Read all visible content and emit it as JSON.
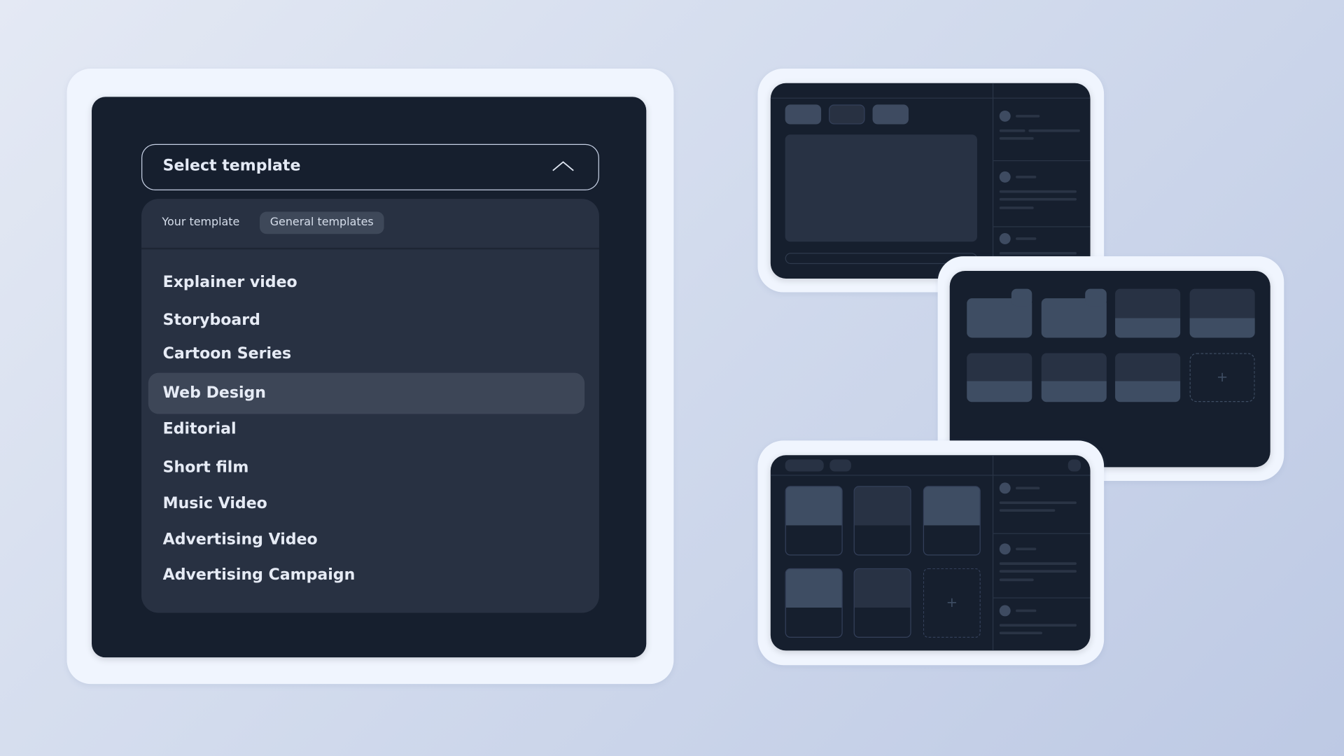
{
  "select": {
    "label": "Select template",
    "icon": "chevron-up-icon",
    "expanded": true
  },
  "tabs": [
    {
      "label": "Your template",
      "active": false
    },
    {
      "label": "General templates",
      "active": true
    }
  ],
  "items": [
    {
      "label": "Explainer video"
    },
    {
      "label": "Storyboard"
    },
    {
      "label": "Cartoon Series"
    },
    {
      "label": "Web Design",
      "selected": true
    },
    {
      "label": "Editorial"
    },
    {
      "label": "Short film"
    },
    {
      "label": "Music Video"
    },
    {
      "label": "Advertising Video"
    },
    {
      "label": "Advertising Campaign"
    }
  ],
  "colors": {
    "panel": "#161f2e",
    "dropdown": "#283142",
    "highlight": "#3d4657",
    "card_frame": "#f0f5fe",
    "placeholder": "#3e4b61"
  }
}
